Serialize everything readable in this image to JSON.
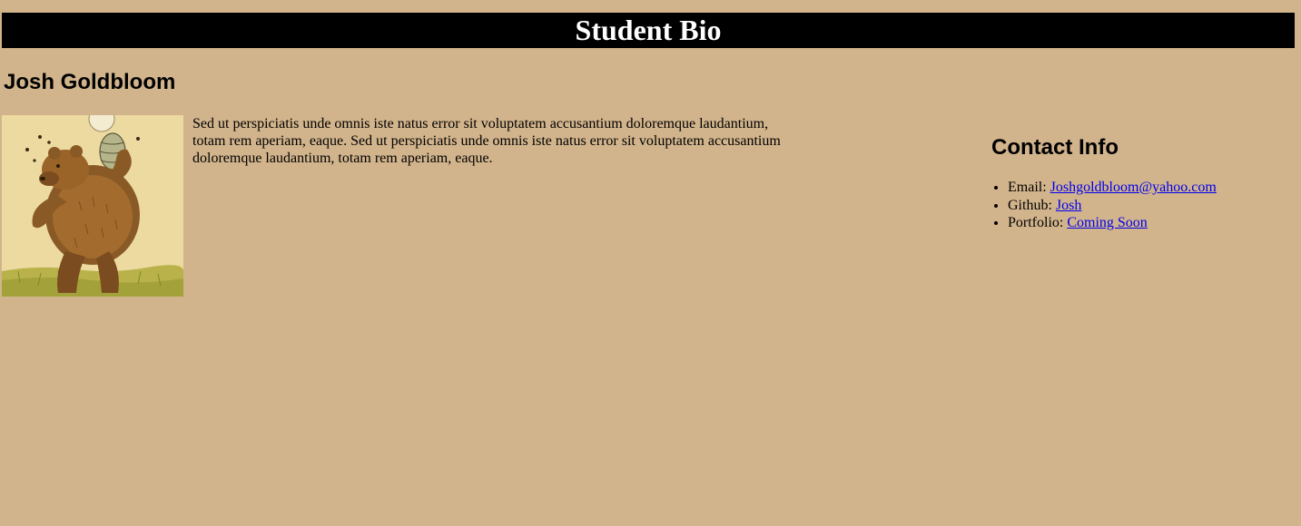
{
  "header": {
    "title": "Student Bio"
  },
  "profile": {
    "name": "Josh Goldbloom",
    "bio": "Sed ut perspiciatis unde omnis iste natus error sit voluptatem accusantium doloremque laudantium, totam rem aperiam, eaque. Sed ut perspiciatis unde omnis iste natus error sit voluptatem accusantium doloremque laudantium, totam rem aperiam, eaque."
  },
  "contact": {
    "title": "Contact Info",
    "items": [
      {
        "label": "Email: ",
        "link_text": "Joshgoldbloom@yahoo.com"
      },
      {
        "label": "Github: ",
        "link_text": "Josh"
      },
      {
        "label": "Portfolio: ",
        "link_text": "Coming Soon"
      }
    ]
  },
  "colors": {
    "page_background": "#d2b48c",
    "header_background": "#000000",
    "header_text": "#ffffff",
    "link": "#0000ee"
  }
}
